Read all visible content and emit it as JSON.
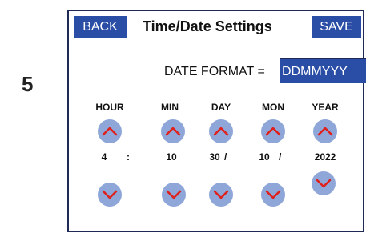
{
  "step_number": "5",
  "header": {
    "back_label": "BACK",
    "title": "Time/Date Settings",
    "save_label": "SAVE"
  },
  "date_format": {
    "label": "DATE FORMAT =",
    "value": "DDMMYYY"
  },
  "fields": [
    {
      "header": "HOUR",
      "value": "4"
    },
    {
      "header": "MIN",
      "value": "10"
    },
    {
      "header": "DAY",
      "value": "30"
    },
    {
      "header": "MON",
      "value": "10"
    },
    {
      "header": "YEAR",
      "value": "2022"
    }
  ],
  "separators": {
    "time": ":",
    "date": "/"
  },
  "colors": {
    "button_bg": "#2a4da6",
    "arrow_circle": "#8ea6d8",
    "arrow_chevron": "#e0201c",
    "panel_border": "#1f2a56"
  },
  "icons": {
    "up": "chevron-up-icon",
    "down": "chevron-down-icon"
  }
}
